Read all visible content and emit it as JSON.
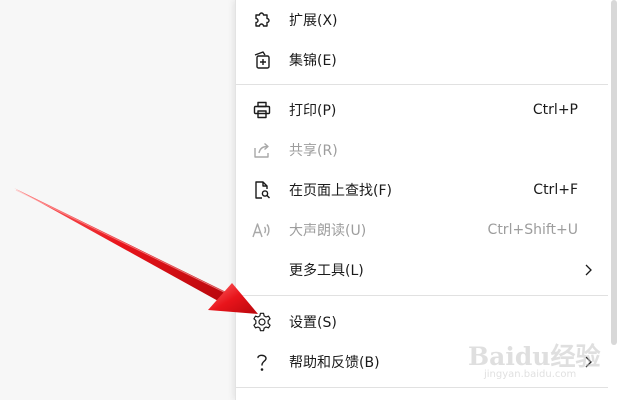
{
  "menu": {
    "items": [
      {
        "id": "extensions",
        "label": "扩展(X)",
        "shortcut": "",
        "icon": "puzzle-icon",
        "disabled": false,
        "submenu": false
      },
      {
        "id": "collections",
        "label": "集锦(E)",
        "shortcut": "",
        "icon": "collections-icon",
        "disabled": false,
        "submenu": false
      },
      {
        "id": "print",
        "label": "打印(P)",
        "shortcut": "Ctrl+P",
        "icon": "printer-icon",
        "disabled": false,
        "submenu": false
      },
      {
        "id": "share",
        "label": "共享(R)",
        "shortcut": "",
        "icon": "share-icon",
        "disabled": true,
        "submenu": false
      },
      {
        "id": "find",
        "label": "在页面上查找(F)",
        "shortcut": "Ctrl+F",
        "icon": "find-on-page-icon",
        "disabled": false,
        "submenu": false
      },
      {
        "id": "read-aloud",
        "label": "大声朗读(U)",
        "shortcut": "Ctrl+Shift+U",
        "icon": "read-aloud-icon",
        "disabled": true,
        "submenu": false
      },
      {
        "id": "more-tools",
        "label": "更多工具(L)",
        "shortcut": "",
        "icon": "",
        "disabled": false,
        "submenu": true
      },
      {
        "id": "settings",
        "label": "设置(S)",
        "shortcut": "",
        "icon": "gear-icon",
        "disabled": false,
        "submenu": false
      },
      {
        "id": "help",
        "label": "帮助和反馈(B)",
        "shortcut": "",
        "icon": "question-icon",
        "disabled": false,
        "submenu": true
      }
    ]
  },
  "watermark": {
    "brand": "Baidu经验",
    "url": "jingyan.baidu.com"
  },
  "colors": {
    "arrow": "#e8141b",
    "text": "#1b1b1b",
    "disabled_text": "#9d9d9d",
    "divider": "#e1e1e1"
  }
}
